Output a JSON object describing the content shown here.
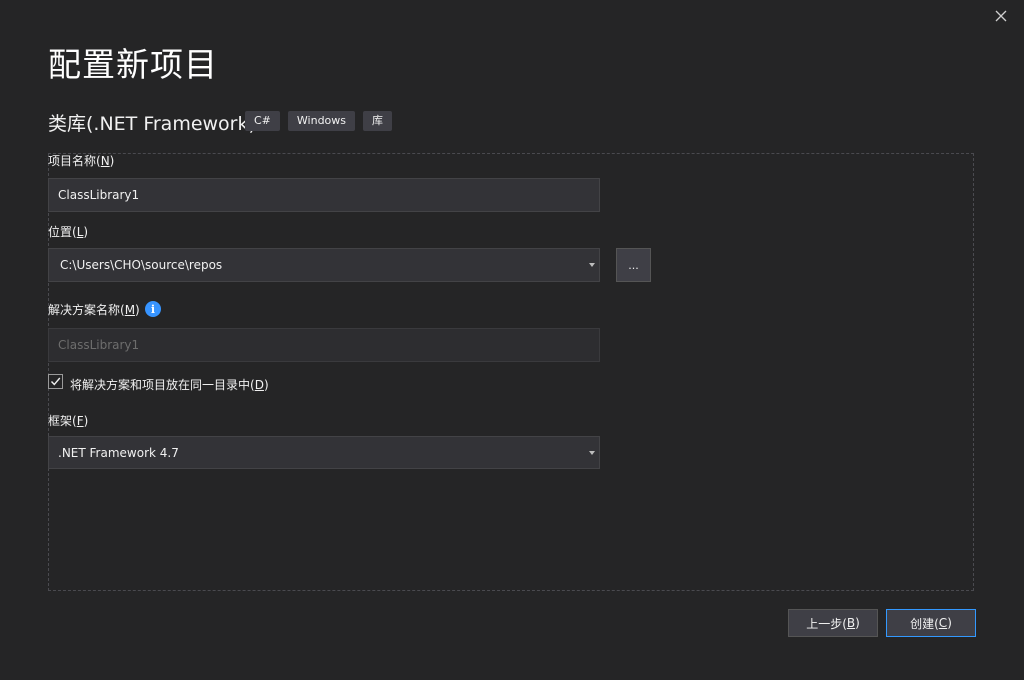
{
  "dialog": {
    "title": "配置新项目",
    "template_name": "类库(.NET Framework)",
    "tags": [
      "C#",
      "Windows",
      "库"
    ]
  },
  "form": {
    "project_name": {
      "label": "项目名称(",
      "key": "N",
      "value": "ClassLibrary1"
    },
    "location": {
      "label": "位置(",
      "key": "L",
      "value": "C:\\Users\\CHO\\source\\repos",
      "browse_label": "..."
    },
    "solution_name": {
      "label": "解决方案名称(",
      "key": "M",
      "value": "ClassLibrary1",
      "info_icon": "i"
    },
    "same_dir": {
      "label": "将解决方案和项目放在同一目录中(",
      "key": "D",
      "checked": true
    },
    "framework": {
      "label": "框架(",
      "key": "F",
      "value": ".NET Framework 4.7"
    }
  },
  "buttons": {
    "back": {
      "label": "上一步(",
      "key": "B"
    },
    "create": {
      "label": "创建(",
      "key": "C"
    }
  },
  "close_paren": ")",
  "colors": {
    "accent": "#3399ff",
    "background": "#252526",
    "info": "#3794ff"
  }
}
